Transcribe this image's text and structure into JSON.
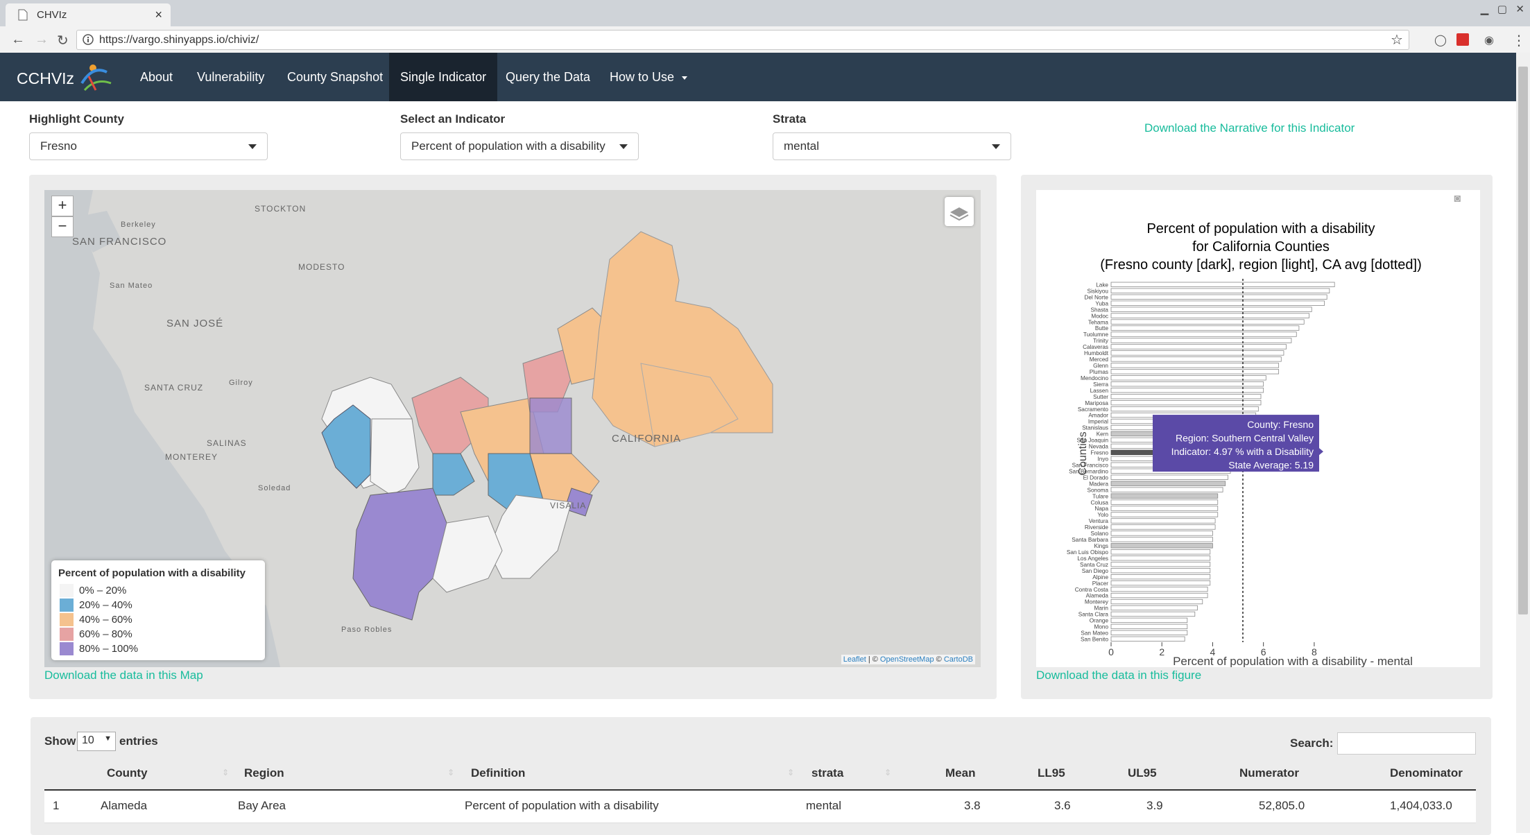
{
  "browser": {
    "tab_title": "CHVIz",
    "url": "https://vargo.shinyapps.io/chiviz/"
  },
  "nav": {
    "brand": "CCHVIz",
    "items": [
      "About",
      "Vulnerability",
      "County Snapshot",
      "Single Indicator",
      "Query the Data",
      "How to Use"
    ],
    "active": "Single Indicator"
  },
  "controls": {
    "county_label": "Highlight County",
    "county_value": "Fresno",
    "indicator_label": "Select an Indicator",
    "indicator_value": "Percent of population with a disability",
    "strata_label": "Strata",
    "strata_value": "mental",
    "narrative_link": "Download the Narrative for this Indicator"
  },
  "map": {
    "place_labels": [
      "STOCKTON",
      "Berkeley",
      "SAN FRANCISCO",
      "MODESTO",
      "San Mateo",
      "SAN JOSÉ",
      "SANTA CRUZ",
      "Gilroy",
      "SALINAS",
      "MONTEREY",
      "Soledad",
      "CALIFORNIA",
      "VISALIA",
      "Paso Robles"
    ],
    "legend_title": "Percent of population with a disability",
    "legend": [
      {
        "label": "0% – 20%",
        "color": "#f4f4f4"
      },
      {
        "label": "20% – 40%",
        "color": "#6baed6"
      },
      {
        "label": "40% – 60%",
        "color": "#f5c28e"
      },
      {
        "label": "60% – 80%",
        "color": "#e6a3a3"
      },
      {
        "label": "80% – 100%",
        "color": "#9a89d0"
      }
    ],
    "attribution_leaflet": "Leaflet",
    "attribution_sep": "| ©",
    "attribution_osm": "OpenStreetMap",
    "attribution_copy": "©",
    "attribution_carto": "CartoDB",
    "download_link": "Download the data in this Map",
    "zoom_in": "+",
    "zoom_out": "−"
  },
  "chart_data": {
    "type": "bar",
    "orientation": "horizontal",
    "title_lines": [
      "Percent of population with a disability",
      "for California Counties",
      "(Fresno county [dark], region [light], CA avg [dotted])"
    ],
    "xlabel": "Percent of population with a disability - mental",
    "ylabel": "Counties",
    "xlim": [
      0,
      9
    ],
    "xticks": [
      0,
      2,
      4,
      6,
      8
    ],
    "state_average": 5.19,
    "categories": [
      "Lake",
      "Siskiyou",
      "Del Norte",
      "Yuba",
      "Shasta",
      "Modoc",
      "Tehama",
      "Butte",
      "Tuolumne",
      "Trinity",
      "Calaveras",
      "Humboldt",
      "Merced",
      "Glenn",
      "Plumas",
      "Mendocino",
      "Sierra",
      "Lassen",
      "Sutter",
      "Mariposa",
      "Sacramento",
      "Amador",
      "Imperial",
      "Stanislaus",
      "Kern",
      "San Joaquin",
      "Nevada",
      "Fresno",
      "Inyo",
      "San Francisco",
      "San Bernardino",
      "El Dorado",
      "Madera",
      "Sonoma",
      "Tulare",
      "Colusa",
      "Napa",
      "Yolo",
      "Ventura",
      "Riverside",
      "Solano",
      "Santa Barbara",
      "Kings",
      "San Luis Obispo",
      "Los Angeles",
      "Santa Cruz",
      "San Diego",
      "Alpine",
      "Placer",
      "Contra Costa",
      "Alameda",
      "Monterey",
      "Marin",
      "Santa Clara",
      "Orange",
      "Mono",
      "San Mateo",
      "San Benito"
    ],
    "values": [
      8.8,
      8.6,
      8.5,
      8.4,
      7.9,
      7.8,
      7.6,
      7.4,
      7.3,
      7.1,
      6.9,
      6.8,
      6.7,
      6.6,
      6.6,
      6.1,
      6.0,
      6.0,
      5.9,
      5.9,
      5.8,
      5.7,
      5.6,
      5.5,
      5.1,
      5.0,
      5.0,
      4.97,
      4.9,
      4.8,
      4.7,
      4.6,
      4.5,
      4.4,
      4.2,
      4.2,
      4.2,
      4.2,
      4.1,
      4.1,
      4.0,
      4.0,
      4.0,
      3.9,
      3.9,
      3.9,
      3.9,
      3.9,
      3.9,
      3.8,
      3.8,
      3.6,
      3.4,
      3.3,
      3.0,
      3.0,
      3.0,
      2.9
    ],
    "highlight": "Fresno",
    "region_counties": [
      "Fresno",
      "Kern",
      "Kings",
      "Madera",
      "Tulare"
    ],
    "tooltip": [
      "County: Fresno",
      "Region: Southern Central Valley",
      "Indicator: 4.97 % with a Disability",
      "State Average: 5.19"
    ],
    "download_link": "Download the data in this figure"
  },
  "table": {
    "show_label": "Show",
    "entries_value": "10",
    "entries_label": "entries",
    "search_label": "Search:",
    "columns": [
      "County",
      "Region",
      "Definition",
      "strata",
      "Mean",
      "LL95",
      "UL95",
      "Numerator",
      "Denominator"
    ],
    "rows": [
      [
        "1",
        "Alameda",
        "Bay Area",
        "Percent of population with a disability",
        "mental",
        "3.8",
        "3.6",
        "3.9",
        "52,805.0",
        "1,404,033.0"
      ]
    ]
  },
  "colors": {
    "navbar": "#2c3e50",
    "accent": "#18bc9c",
    "tooltip": "#5b4aa7"
  }
}
